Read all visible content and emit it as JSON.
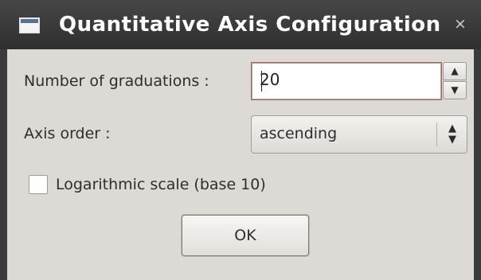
{
  "window": {
    "title": "Quantitative Axis Configuration",
    "close_glyph": "×"
  },
  "form": {
    "graduations_label": "Number of graduations :",
    "graduations_value": "20",
    "axis_order_label": "Axis order :",
    "axis_order_value": "ascending",
    "log_scale_label": "Logarithmic scale (base 10)",
    "log_scale_checked": false
  },
  "buttons": {
    "ok_label": "OK"
  },
  "icons": {
    "window_icon": "window-icon",
    "spin_up": "▲",
    "spin_down": "▼",
    "combo_arrows": "▲▼"
  }
}
